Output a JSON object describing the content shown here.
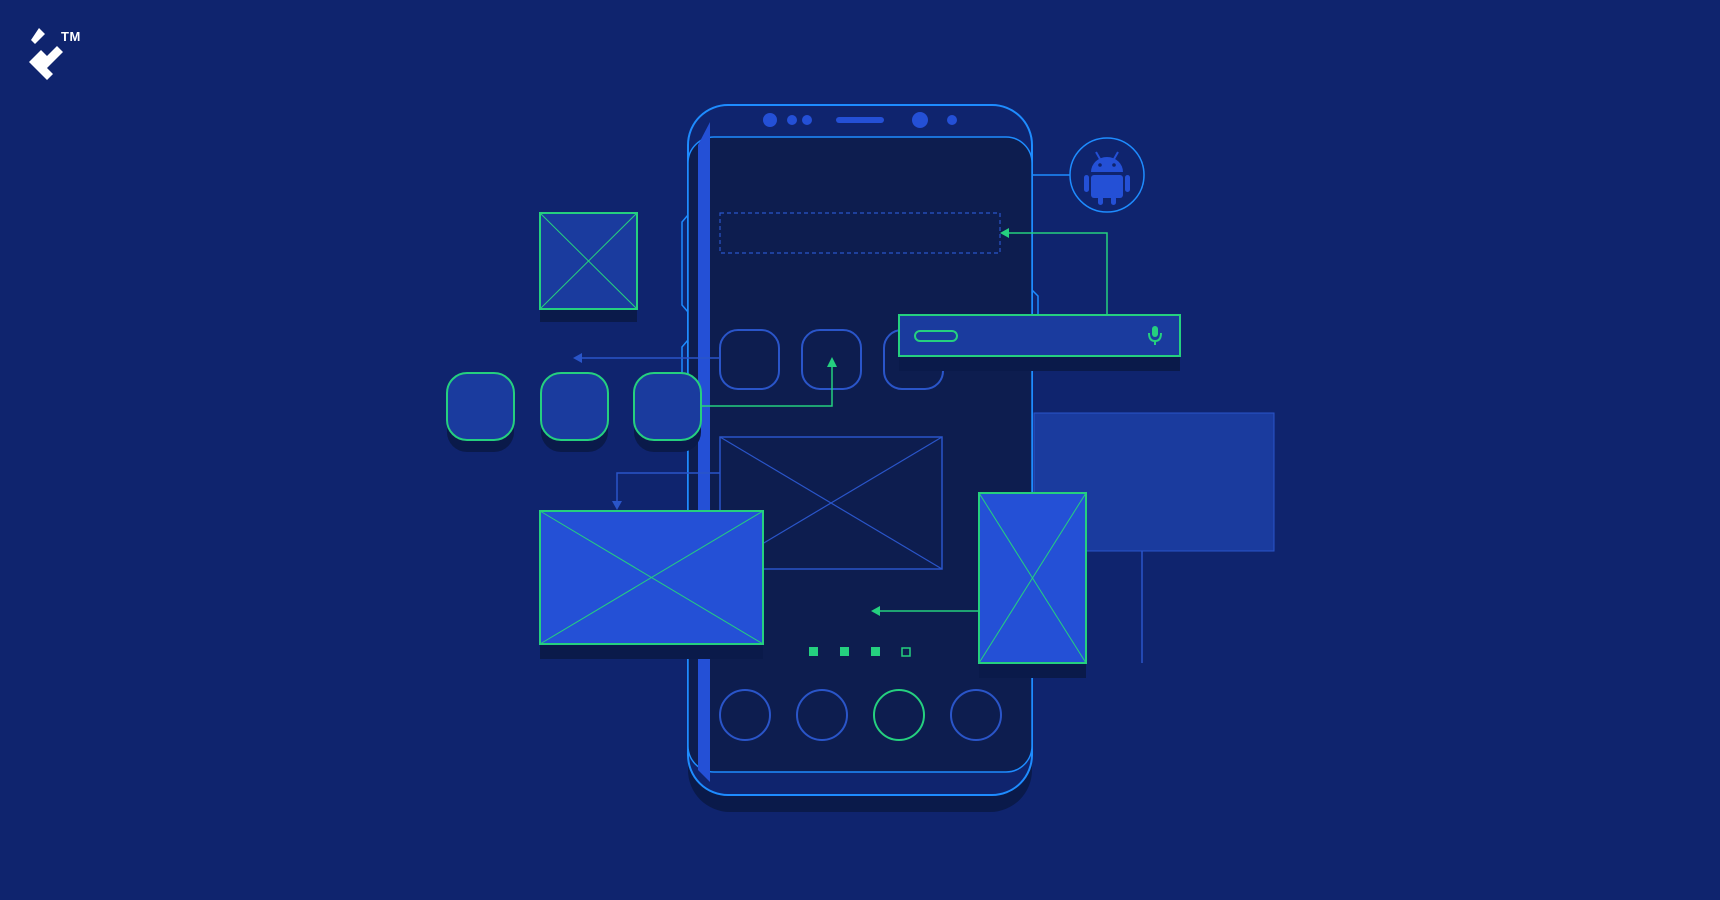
{
  "brand": {
    "trademark": "TM",
    "logo_icon": "toptal-logo-icon"
  },
  "colors": {
    "background": "#0f246e",
    "phone_outline": "#1e8cff",
    "screen": "#0d1d4f",
    "accent_green": "#25d07f",
    "panel_blue": "#1a3b9e",
    "panel_bright": "#2450d6",
    "shadow": "#0a1a4a"
  },
  "icons": {
    "platform": "android-icon",
    "voice": "microphone-icon"
  },
  "pager": {
    "total": 4,
    "active_filled": 3
  }
}
